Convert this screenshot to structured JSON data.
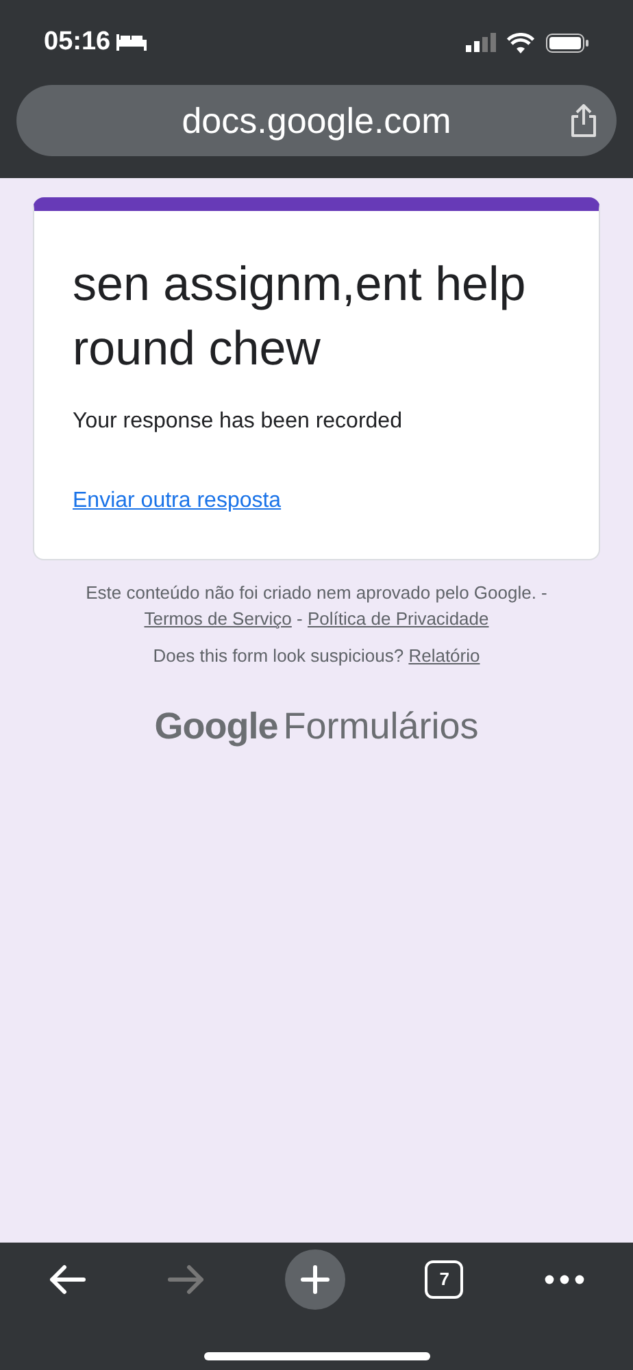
{
  "status_bar": {
    "time": "05:16"
  },
  "address_bar": {
    "url": "docs.google.com"
  },
  "form": {
    "title": "sen assignm,ent help round chew",
    "message": "Your response has been recorded",
    "link": "Enviar outra resposta"
  },
  "footer": {
    "disclaimer": "Este conteúdo não foi criado nem aprovado pelo Google. -",
    "terms_link": "Termos de Serviço",
    "separator": "-",
    "privacy_link": "Política de Privacidade",
    "question": "Does this form look suspicious?",
    "report_link": "Relatório",
    "brand": "Google",
    "product": "Formulários"
  },
  "toolbar": {
    "back_disabled": false,
    "forward_disabled": true,
    "tab_count": "7"
  }
}
